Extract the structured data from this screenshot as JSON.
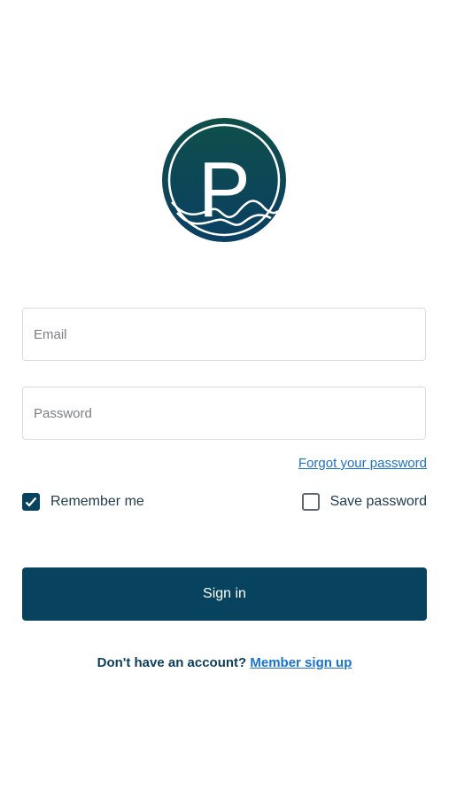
{
  "brand": {
    "logo_letter": "P",
    "primary_color": "#07435f",
    "logo_gradient_top": "#0f4f4a",
    "logo_gradient_bottom": "#0a3f63",
    "link_color": "#1a73c9"
  },
  "form": {
    "email_placeholder": "Email",
    "password_placeholder": "Password",
    "forgot_password_label": "Forgot your password",
    "remember_me_label": "Remember me",
    "remember_me_checked": true,
    "save_password_label": "Save password",
    "save_password_checked": false,
    "sign_in_label": "Sign in"
  },
  "footer": {
    "prompt_text": "Don't have an account?",
    "signup_link_label": "Member sign up"
  }
}
